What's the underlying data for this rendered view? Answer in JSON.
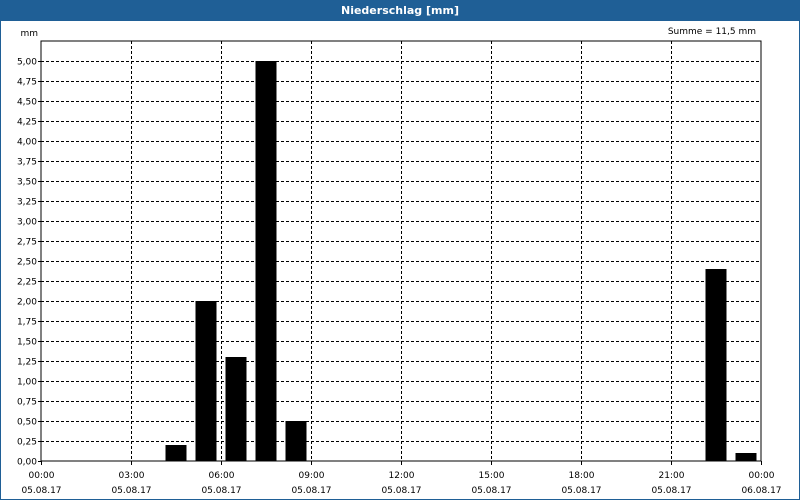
{
  "window": {
    "title": "Niederschlag [mm]"
  },
  "chart_data": {
    "type": "bar",
    "title": "Niederschlag [mm]",
    "annotation": "Summe = 11,5 mm",
    "ylabel": "mm",
    "ylim": [
      0,
      5.25
    ],
    "y_ticks": [
      "0,00",
      "0,25",
      "0,50",
      "0,75",
      "1,00",
      "1,25",
      "1,50",
      "1,75",
      "2,00",
      "2,25",
      "2,50",
      "2,75",
      "3,00",
      "3,25",
      "3,50",
      "3,75",
      "4,00",
      "4,25",
      "4,50",
      "4,75",
      "5,00"
    ],
    "x_ticks": [
      {
        "time": "00:00",
        "date": "05.08.17"
      },
      {
        "time": "03:00",
        "date": "05.08.17"
      },
      {
        "time": "06:00",
        "date": "05.08.17"
      },
      {
        "time": "09:00",
        "date": "05.08.17"
      },
      {
        "time": "12:00",
        "date": "05.08.17"
      },
      {
        "time": "15:00",
        "date": "05.08.17"
      },
      {
        "time": "18:00",
        "date": "05.08.17"
      },
      {
        "time": "21:00",
        "date": "05.08.17"
      },
      {
        "time": "00:00",
        "date": "06.08.17"
      }
    ],
    "categories": [
      "04:00-05:00",
      "05:00-06:00",
      "06:00-07:00",
      "07:00-08:00",
      "08:00-09:00",
      "22:00-23:00",
      "23:00-00:00"
    ],
    "values": [
      0.2,
      2.0,
      1.3,
      5.0,
      0.5,
      2.4,
      0.1
    ],
    "grid": true,
    "bar_color": "#000000"
  }
}
